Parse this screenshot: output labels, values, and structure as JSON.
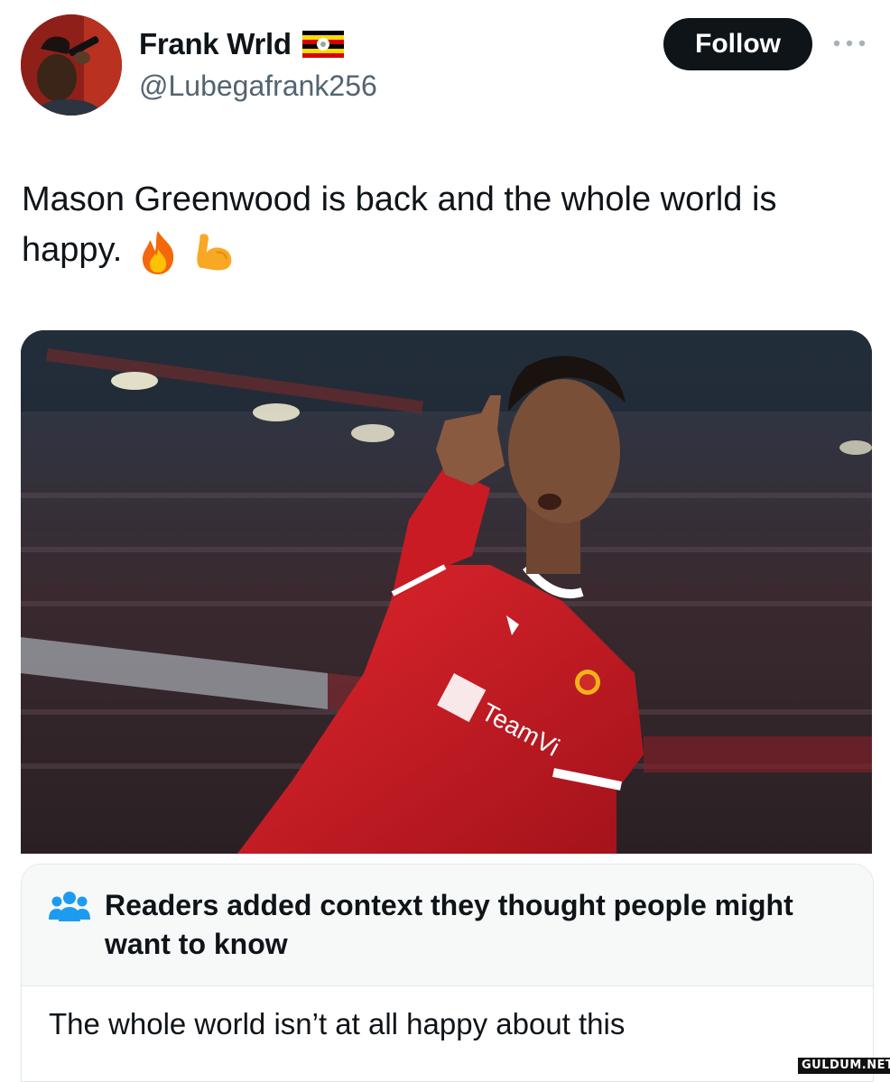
{
  "author": {
    "display_name": "Frank Wrld",
    "handle": "@Lubegafrank256",
    "flag": "uganda-flag-icon"
  },
  "actions": {
    "follow_label": "Follow",
    "more_icon": "more-horizontal-icon"
  },
  "tweet": {
    "text": "Mason Greenwood is back and the whole world is happy.",
    "emojis": [
      "fire-emoji",
      "flexed-biceps-emoji"
    ]
  },
  "media": {
    "jersey_text": "TeamVi"
  },
  "community_note": {
    "icon": "people-group-icon",
    "title": "Readers added context they thought people might want to know",
    "body": "The whole world isn’t at all happy about this"
  },
  "watermark": "GULDUM.NET",
  "colors": {
    "follow_bg": "#0f1419",
    "secondary_text": "#536471",
    "note_icon_blue": "#1d9bf0",
    "note_header_bg": "#f7f9f9"
  }
}
